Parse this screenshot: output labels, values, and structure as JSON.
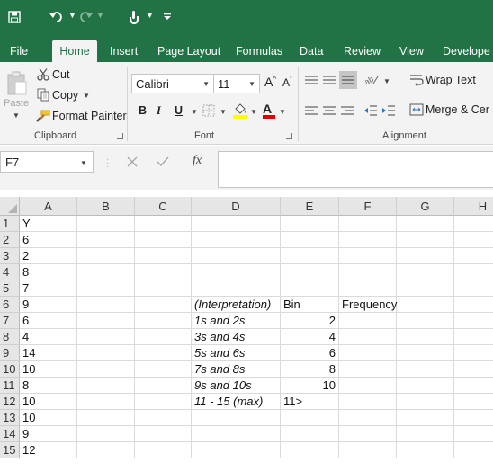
{
  "qat": {
    "save_icon": "save-icon",
    "undo_icon": "undo-icon",
    "redo_icon": "redo-icon",
    "touch_icon": "touch-mode-icon",
    "customize_icon": "customize-qat-icon"
  },
  "tabs": [
    "File",
    "Home",
    "Insert",
    "Page Layout",
    "Formulas",
    "Data",
    "Review",
    "View",
    "Develope"
  ],
  "active_tab": "Home",
  "ribbon": {
    "clipboard": {
      "paste_label": "Paste",
      "cut_label": "Cut",
      "copy_label": "Copy",
      "format_painter_label": "Format Painter",
      "group_label": "Clipboard"
    },
    "font": {
      "font_name": "Calibri",
      "font_size": "11",
      "bold_label": "B",
      "italic_label": "I",
      "underline_label": "U",
      "grow_label": "A",
      "shrink_label": "A",
      "font_color_label": "A",
      "group_label": "Font"
    },
    "alignment": {
      "wrap_text_label": "Wrap Text",
      "merge_label": "Merge & Cer",
      "group_label": "Alignment"
    }
  },
  "formula_bar": {
    "name_box": "F7",
    "fx_label": "fx",
    "formula": ""
  },
  "columns": [
    "A",
    "B",
    "C",
    "D",
    "E",
    "F",
    "G",
    "H"
  ],
  "rows": [
    {
      "n": "1",
      "A": "Y"
    },
    {
      "n": "2",
      "A": "6"
    },
    {
      "n": "3",
      "A": "2"
    },
    {
      "n": "4",
      "A": "8"
    },
    {
      "n": "5",
      "A": "7"
    },
    {
      "n": "6",
      "A": "9",
      "D": "(Interpretation)",
      "E": "Bin",
      "F": "Frequency"
    },
    {
      "n": "7",
      "A": "6",
      "D": "1s and 2s",
      "E": "2"
    },
    {
      "n": "8",
      "A": "4",
      "D": "3s and 4s",
      "E": "4"
    },
    {
      "n": "9",
      "A": "14",
      "D": "5s and 6s",
      "E": "6"
    },
    {
      "n": "10",
      "A": "10",
      "D": "7s and 8s",
      "E": "8"
    },
    {
      "n": "11",
      "A": "8",
      "D": "9s and 10s",
      "E": "10"
    },
    {
      "n": "12",
      "A": "10",
      "D": "11 - 15 (max)",
      "E": "11>"
    },
    {
      "n": "13",
      "A": "10"
    },
    {
      "n": "14",
      "A": "9"
    },
    {
      "n": "15",
      "A": "12"
    }
  ],
  "colors": {
    "excel_green": "#217346",
    "ribbon_bg": "#f3f3f3",
    "header_bg": "#e6e6e6"
  }
}
